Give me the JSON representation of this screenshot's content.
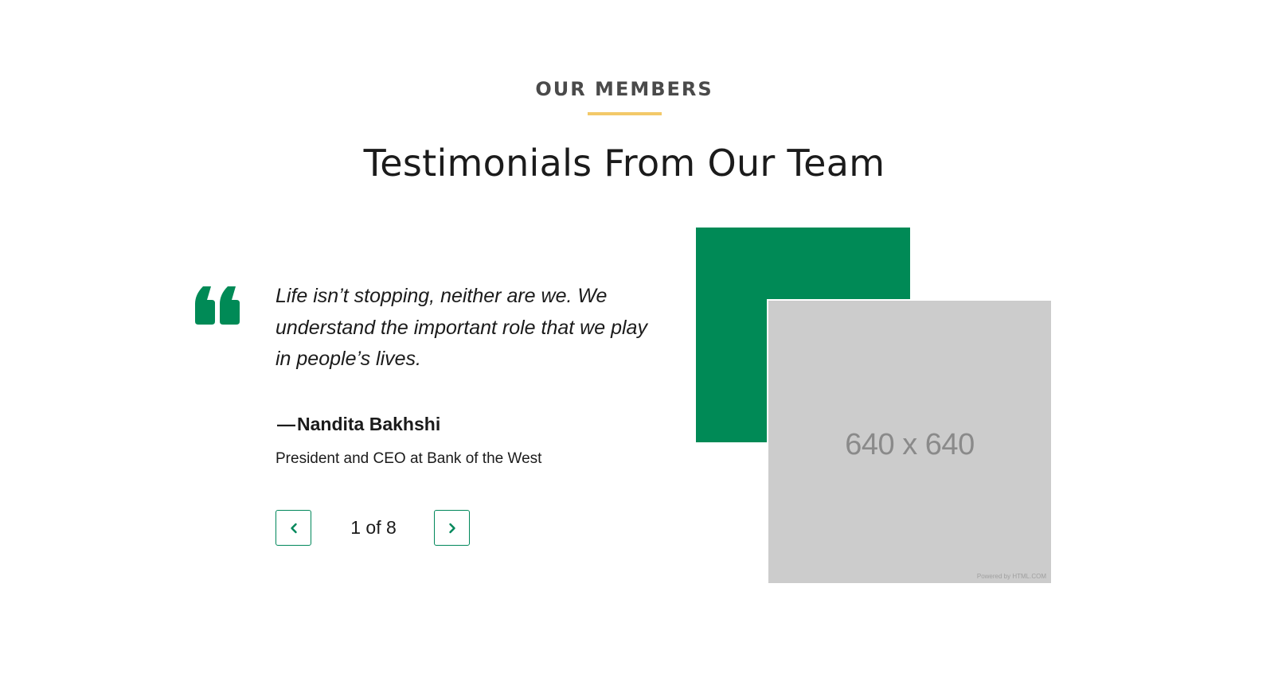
{
  "section": {
    "eyebrow": "OUR MEMBERS",
    "heading": "Testimonials From Our Team"
  },
  "testimonial": {
    "quote": "Life isn’t stopping, neither are we. We understand the important role that we play in people’s lives.",
    "author_dash": "—",
    "author_name": "Nandita Bakhshi",
    "author_role": "President and CEO at Bank of the West"
  },
  "pager": {
    "current_label": "1 of 8",
    "prev_icon": "chevron-left-icon",
    "next_icon": "chevron-right-icon"
  },
  "image": {
    "placeholder_label": "640 x 640",
    "credit": "Powered by HTML.COM"
  },
  "colors": {
    "accent_green": "#008a56",
    "accent_yellow": "#f3c969",
    "placeholder_gray": "#cccccc"
  },
  "icons": {
    "quote": "quote-icon"
  }
}
